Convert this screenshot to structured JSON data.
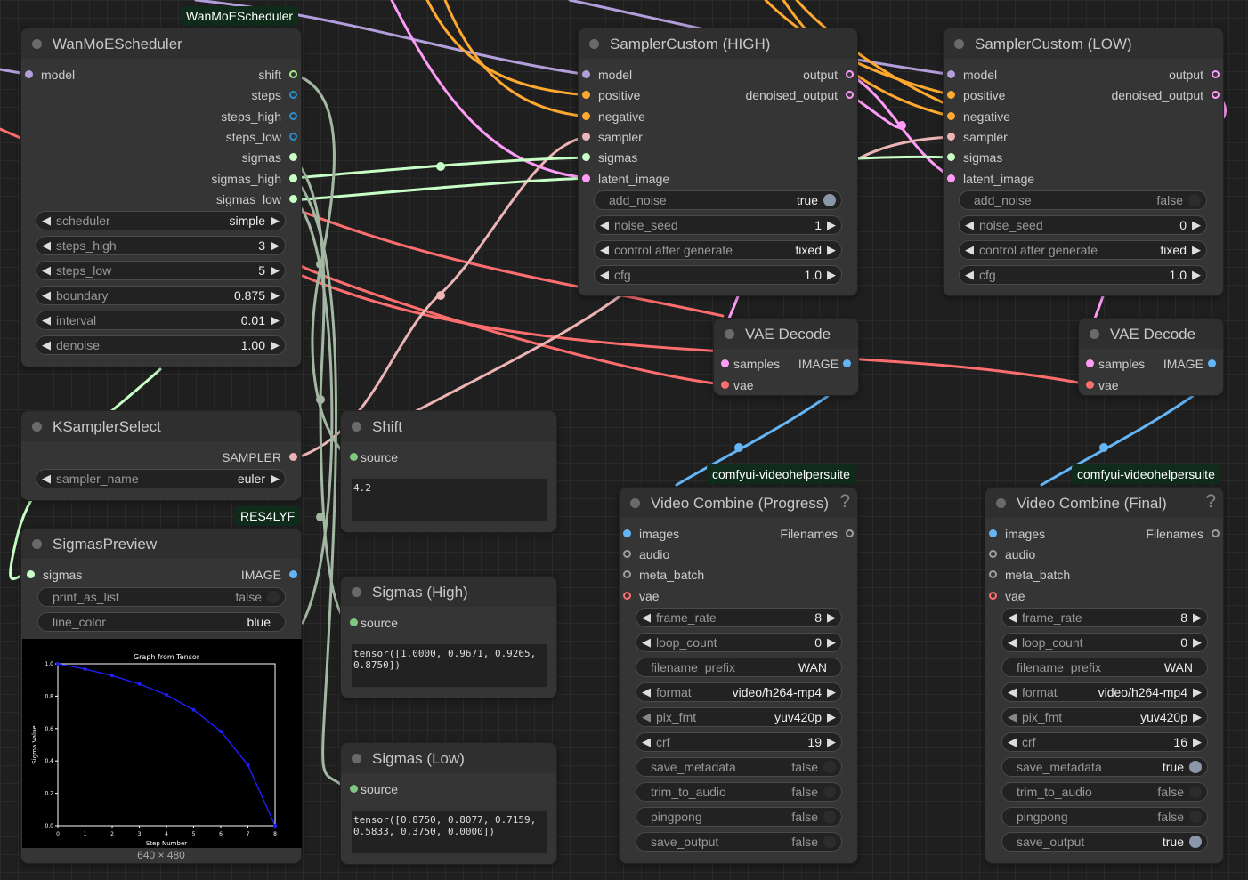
{
  "colors": {
    "model": "#b39ddb",
    "cond": "#ffa931",
    "sampler": "#ecb4b4",
    "sigmas": "#c7ffc7",
    "latent": "#ff9cf9",
    "vae": "#ff6e6e",
    "image": "#64b5f6",
    "float": "#aaee88",
    "int": "#2a8ccb",
    "mask": "#81c784",
    "gray": "#9e9e9e"
  },
  "scheduler": {
    "badge": "WanMoEScheduler",
    "title": "WanMoEScheduler",
    "in_model": "model",
    "outs": [
      "shift",
      "steps",
      "steps_high",
      "steps_low",
      "sigmas",
      "sigmas_high",
      "sigmas_low"
    ],
    "widgets": [
      {
        "label": "scheduler",
        "value": "simple"
      },
      {
        "label": "steps_high",
        "value": "3"
      },
      {
        "label": "steps_low",
        "value": "5"
      },
      {
        "label": "boundary",
        "value": "0.875"
      },
      {
        "label": "interval",
        "value": "0.01"
      },
      {
        "label": "denoise",
        "value": "1.00"
      }
    ]
  },
  "ksampler": {
    "title": "KSamplerSelect",
    "out": "SAMPLER",
    "widget": {
      "label": "sampler_name",
      "value": "euler"
    }
  },
  "preview": {
    "badge": "RES4LYF",
    "title": "SigmasPreview",
    "in": "sigmas",
    "out": "IMAGE",
    "widgets": [
      {
        "label": "print_as_list",
        "value": "false"
      },
      {
        "label": "line_color",
        "value": "blue"
      }
    ],
    "size_label": "640 × 480"
  },
  "chart_data": {
    "type": "line",
    "title": "Graph from Tensor",
    "xlabel": "Step Number",
    "ylabel": "Sigma Value",
    "x": [
      0,
      1,
      2,
      3,
      4,
      5,
      6,
      7,
      8
    ],
    "values": [
      1.0,
      0.9671,
      0.9265,
      0.875,
      0.8077,
      0.7159,
      0.5833,
      0.375,
      0.0
    ],
    "xlim": [
      0,
      8
    ],
    "ylim": [
      0,
      1.0
    ],
    "xticks": [
      "0",
      "1",
      "2",
      "3",
      "4",
      "5",
      "6",
      "7",
      "8"
    ],
    "yticks": [
      "0.0",
      "0.2",
      "0.4",
      "0.6",
      "0.8",
      "1.0"
    ],
    "color": "blue",
    "grid": false
  },
  "shift": {
    "title": "Shift",
    "in": "source",
    "text": "4.2"
  },
  "sig_high": {
    "title": "Sigmas (High)",
    "in": "source",
    "text": "tensor([1.0000, 0.9671, 0.9265,\n0.8750])"
  },
  "sig_low": {
    "title": "Sigmas (Low)",
    "in": "source",
    "text": "tensor([0.8750, 0.8077, 0.7159,\n0.5833, 0.3750, 0.0000])"
  },
  "sampler_high": {
    "title": "SamplerCustom (HIGH)",
    "ins": [
      "model",
      "positive",
      "negative",
      "sampler",
      "sigmas",
      "latent_image"
    ],
    "outs": [
      "output",
      "denoised_output"
    ],
    "widgets": [
      {
        "label": "add_noise",
        "value": "true",
        "type": "toggle"
      },
      {
        "label": "noise_seed",
        "value": "1"
      },
      {
        "label": "control after generate",
        "value": "fixed"
      },
      {
        "label": "cfg",
        "value": "1.0"
      }
    ]
  },
  "sampler_low": {
    "title": "SamplerCustom (LOW)",
    "ins": [
      "model",
      "positive",
      "negative",
      "sampler",
      "sigmas",
      "latent_image"
    ],
    "outs": [
      "output",
      "denoised_output"
    ],
    "widgets": [
      {
        "label": "add_noise",
        "value": "false",
        "type": "toggle"
      },
      {
        "label": "noise_seed",
        "value": "0"
      },
      {
        "label": "control after generate",
        "value": "fixed"
      },
      {
        "label": "cfg",
        "value": "1.0"
      }
    ]
  },
  "vae_decode": {
    "title": "VAE Decode",
    "ins": [
      "samples",
      "vae"
    ],
    "out": "IMAGE"
  },
  "video_progress": {
    "badge": "comfyui-videohelpersuite",
    "title": "Video Combine  (Progress)",
    "help": "?",
    "ins": [
      "images",
      "audio",
      "meta_batch",
      "vae"
    ],
    "out": "Filenames",
    "widgets": [
      {
        "label": "frame_rate",
        "value": "8"
      },
      {
        "label": "loop_count",
        "value": "0"
      },
      {
        "label": "filename_prefix",
        "value": "WAN"
      },
      {
        "label": "format",
        "value": "video/h264-mp4"
      },
      {
        "label": "pix_fmt",
        "value": "yuv420p"
      },
      {
        "label": "crf",
        "value": "19"
      },
      {
        "label": "save_metadata",
        "value": "false"
      },
      {
        "label": "trim_to_audio",
        "value": "false"
      },
      {
        "label": "pingpong",
        "value": "false"
      },
      {
        "label": "save_output",
        "value": "false"
      }
    ]
  },
  "video_final": {
    "badge": "comfyui-videohelpersuite",
    "title": "Video Combine  (Final)",
    "help": "?",
    "ins": [
      "images",
      "audio",
      "meta_batch",
      "vae"
    ],
    "out": "Filenames",
    "widgets": [
      {
        "label": "frame_rate",
        "value": "8"
      },
      {
        "label": "loop_count",
        "value": "0"
      },
      {
        "label": "filename_prefix",
        "value": "WAN"
      },
      {
        "label": "format",
        "value": "video/h264-mp4"
      },
      {
        "label": "pix_fmt",
        "value": "yuv420p"
      },
      {
        "label": "crf",
        "value": "16"
      },
      {
        "label": "save_metadata",
        "value": "true"
      },
      {
        "label": "trim_to_audio",
        "value": "false"
      },
      {
        "label": "pingpong",
        "value": "false"
      },
      {
        "label": "save_output",
        "value": "true"
      }
    ]
  }
}
